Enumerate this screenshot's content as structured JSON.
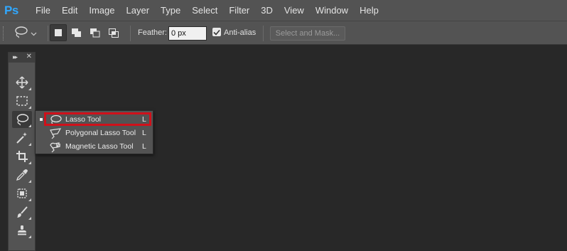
{
  "app": {
    "logo_text": "Ps",
    "accent": "#31a8ff"
  },
  "menu": [
    "File",
    "Edit",
    "Image",
    "Layer",
    "Type",
    "Select",
    "Filter",
    "3D",
    "View",
    "Window",
    "Help"
  ],
  "options": {
    "preset_icon": "lasso-icon",
    "selection_modes": [
      "new-selection",
      "add-to-selection",
      "subtract-from-selection",
      "intersect-with-selection"
    ],
    "feather_label": "Feather:",
    "feather_value": "0 px",
    "antialias_label": "Anti-alias",
    "antialias_checked": true,
    "select_mask_label": "Select and Mask..."
  },
  "tools_panel": {
    "collapse_glyph": "▸▸",
    "close_glyph": "✕",
    "tools": [
      "move-tool",
      "marquee-tool",
      "lasso-tool",
      "magic-wand-tool",
      "crop-tool",
      "eyedropper-tool",
      "patch-tool",
      "brush-tool",
      "clone-stamp-tool"
    ],
    "active_tool": "lasso-tool"
  },
  "flyout": {
    "items": [
      {
        "label": "Lasso Tool",
        "shortcut": "L",
        "icon": "lasso-icon",
        "selected": true
      },
      {
        "label": "Polygonal Lasso Tool",
        "shortcut": "L",
        "icon": "polygonal-lasso-icon",
        "selected": false
      },
      {
        "label": "Magnetic Lasso Tool",
        "shortcut": "L",
        "icon": "magnetic-lasso-icon",
        "selected": false
      }
    ],
    "highlight_color": "#d0101a"
  }
}
